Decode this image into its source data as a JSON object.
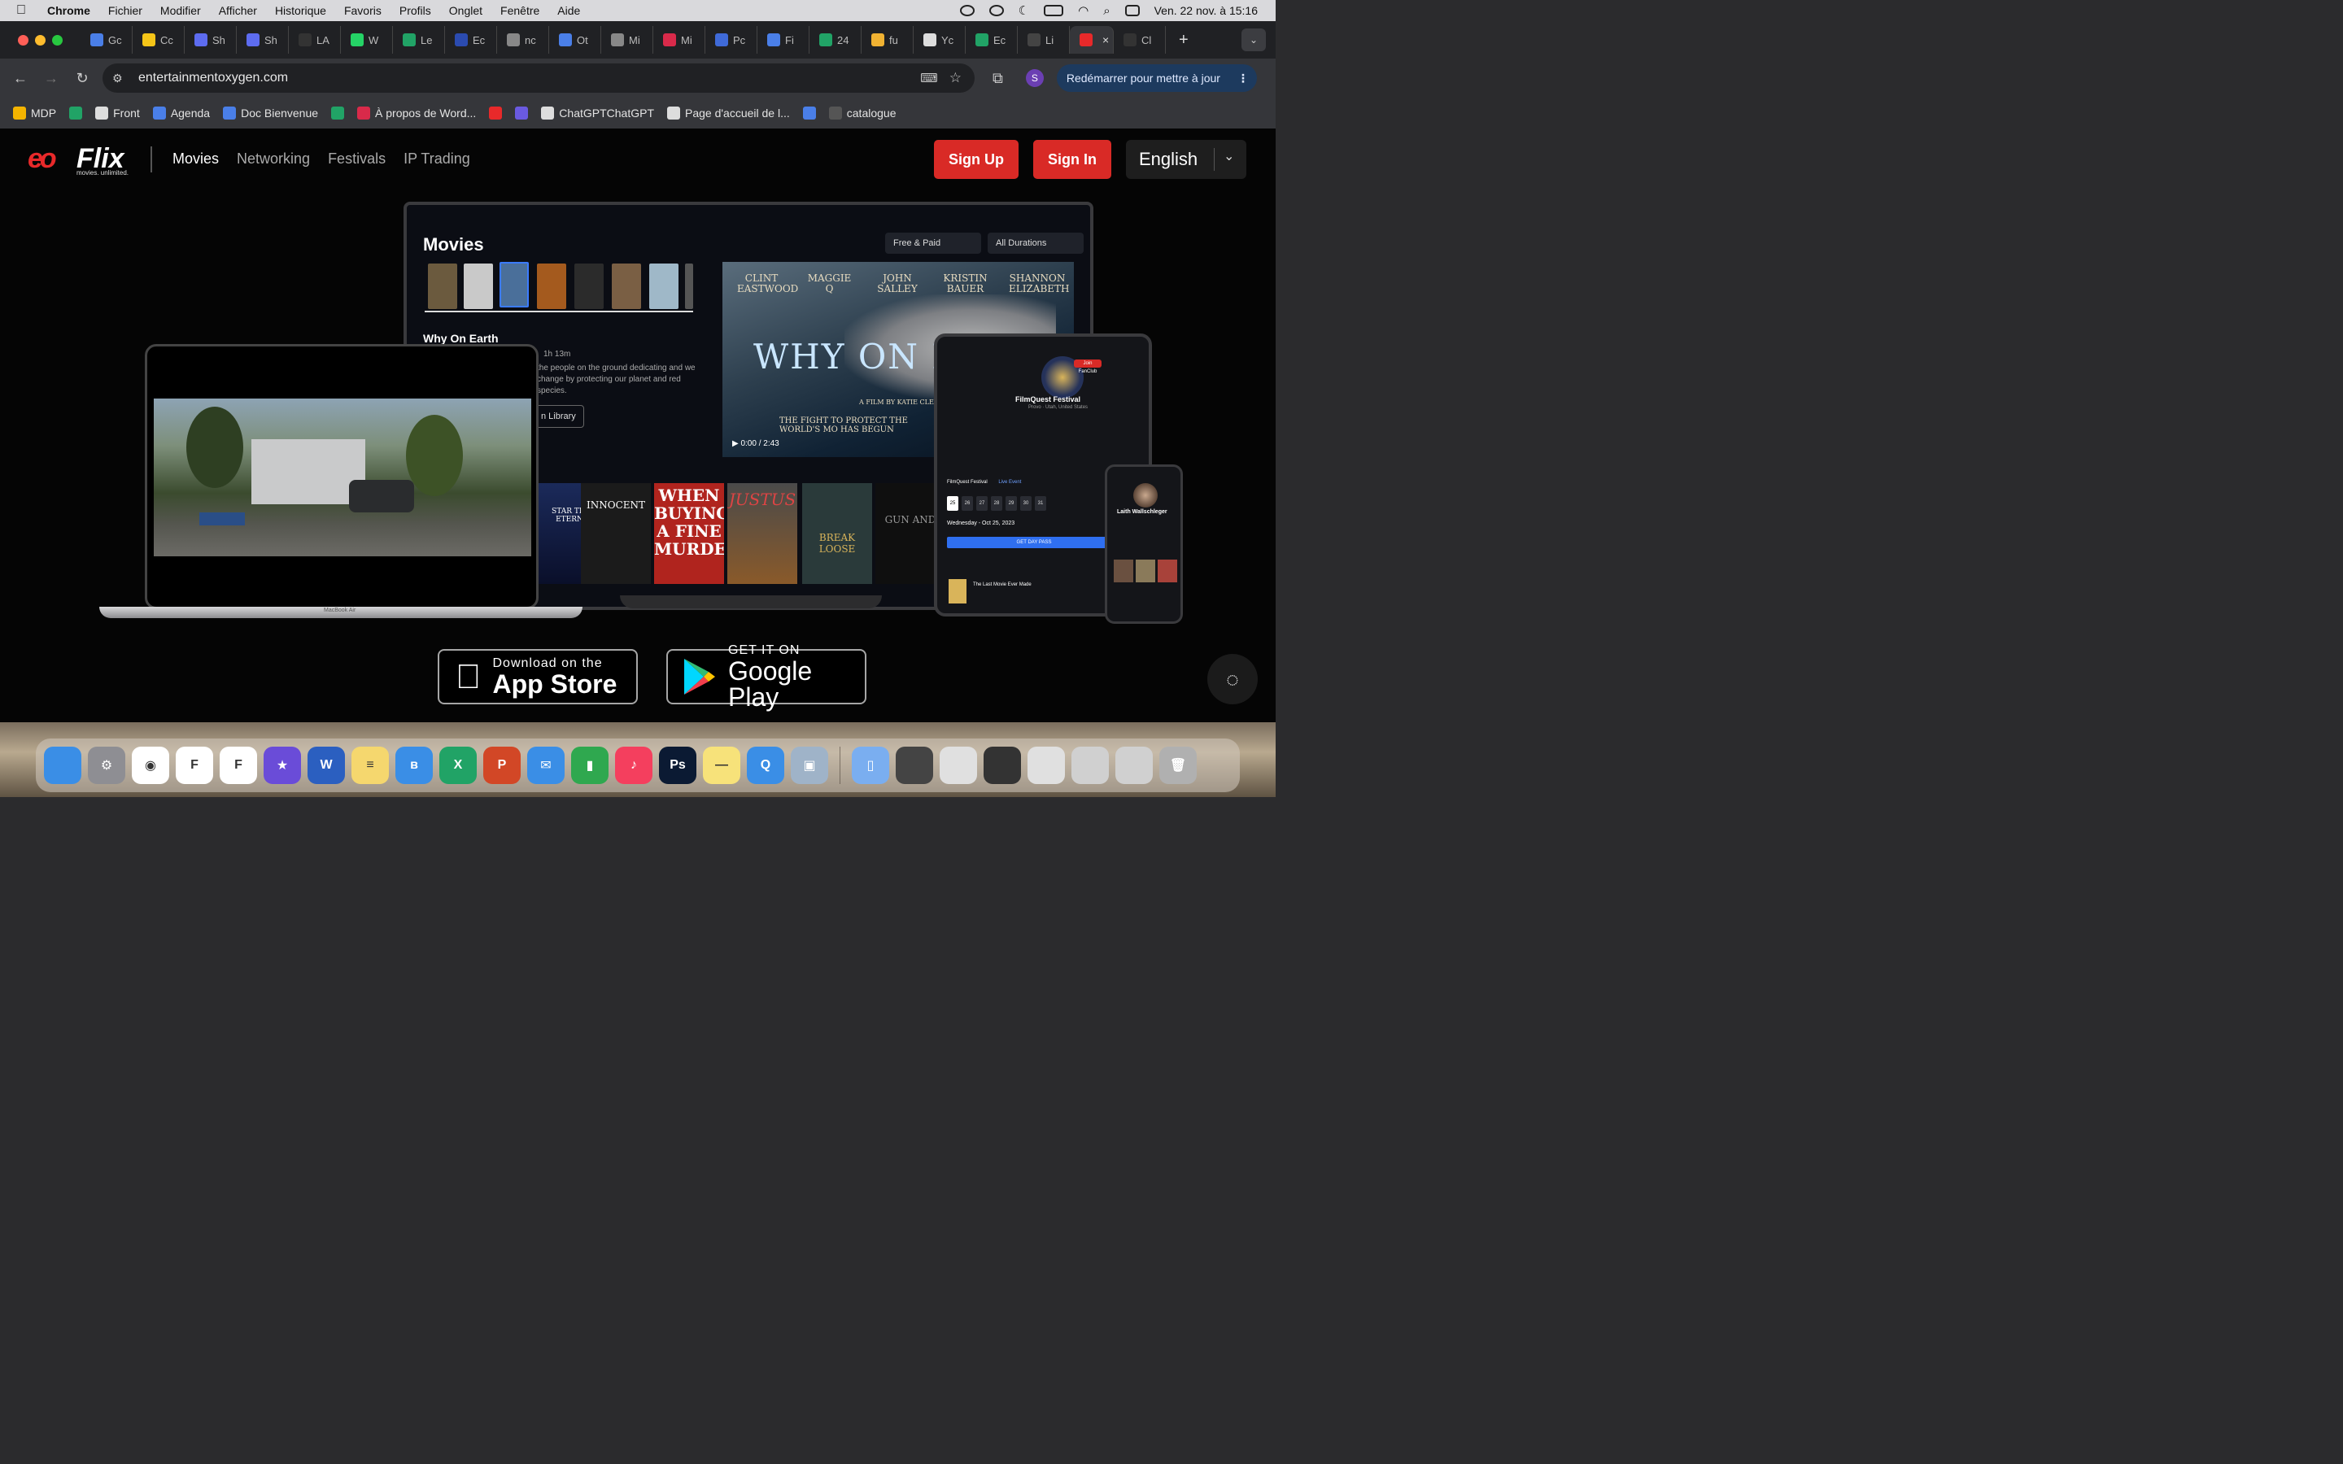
{
  "menubar": {
    "app": "Chrome",
    "items": [
      "Fichier",
      "Modifier",
      "Afficher",
      "Historique",
      "Favoris",
      "Profils",
      "Onglet",
      "Fenêtre",
      "Aide"
    ],
    "datetime": "Ven. 22 nov. à 15:16"
  },
  "tabs": [
    {
      "label": "Gc",
      "color": "#4a7fe8"
    },
    {
      "label": "Cc",
      "color": "#f5c518"
    },
    {
      "label": "Sh",
      "color": "#5d6cf0"
    },
    {
      "label": "Sh",
      "color": "#5d6cf0"
    },
    {
      "label": "LA",
      "color": "#333333"
    },
    {
      "label": "W",
      "color": "#25d366"
    },
    {
      "label": "Le",
      "color": "#21a366"
    },
    {
      "label": "Ec",
      "color": "#2b4bb0"
    },
    {
      "label": "nc",
      "color": "#888888"
    },
    {
      "label": "Ot",
      "color": "#4a7fe8"
    },
    {
      "label": "Mi",
      "color": "#888888"
    },
    {
      "label": "Mi",
      "color": "#d92a4a"
    },
    {
      "label": "Pc",
      "color": "#3f6ad8"
    },
    {
      "label": "Fi",
      "color": "#4a7fe8"
    },
    {
      "label": "24",
      "color": "#21a366"
    },
    {
      "label": "fu",
      "color": "#f0b232"
    },
    {
      "label": "Yc",
      "color": "#dddddd"
    },
    {
      "label": "Ec",
      "color": "#21a366"
    },
    {
      "label": "Li",
      "color": "#444444"
    },
    {
      "label": "",
      "color": "#e8292a",
      "active": true,
      "close": "×"
    },
    {
      "label": "Cl",
      "color": "#333333"
    }
  ],
  "newtab": "+",
  "toolbar": {
    "url": "entertainmentoxygen.com",
    "profile_initial": "S",
    "update_label": "Redémarrer pour mettre à jour",
    "update_dots": "⋮"
  },
  "bookmarks": [
    {
      "label": "MDP",
      "color": "#f4b400"
    },
    {
      "label": "",
      "color": "#21a366"
    },
    {
      "label": "Front",
      "color": "#dddddd"
    },
    {
      "label": "Agenda",
      "color": "#4a7fe8"
    },
    {
      "label": "Doc Bienvenue",
      "color": "#4a7fe8"
    },
    {
      "label": "",
      "color": "#21a366"
    },
    {
      "label": "À propos de Word...",
      "color": "#d92a4a"
    },
    {
      "label": "",
      "color": "#e8292a"
    },
    {
      "label": "",
      "color": "#6a5ae0"
    },
    {
      "label": "ChatGPTChatGPT",
      "color": "#dddddd"
    },
    {
      "label": "Page d'accueil de l...",
      "color": "#dddddd"
    },
    {
      "label": "",
      "color": "#4a7fe8"
    },
    {
      "label": "catalogue",
      "color": "#555555"
    }
  ],
  "site": {
    "logo_word": "Flix",
    "logo_tag": "movies. unlimited.",
    "nav": [
      "Movies",
      "Networking",
      "Festivals",
      "IP Trading"
    ],
    "signup": "Sign Up",
    "signin": "Sign In",
    "language": "English",
    "brand_red": "#d92a26"
  },
  "tv": {
    "title": "Movies",
    "filter1": "Free & Paid",
    "filter2": "All Durations",
    "cast": [
      "CLINT EASTWOOD",
      "MAGGIE Q",
      "JOHN SALLEY",
      "KRISTIN BAUER",
      "SHANNON ELIZABETH"
    ],
    "hero_title": "WHY ON E",
    "hero_credit": "A FILM BY KATIE CLEARY",
    "hero_tagline": "THE FIGHT TO PROTECT THE WORLD'S MO HAS BEGUN",
    "time": "0:00 / 2:43",
    "selected_title": "Why On Earth",
    "duration": "1h 13m",
    "description": "the people on the ground dedicating and we change by protecting our planet and red species.",
    "library_btn": "n Library",
    "row_titles": [
      "STAR TREK ETERNIA",
      "INNOCENT",
      "WHEN BUYING A FINE MURDER",
      "JUSTUS",
      "BREAK LOOSE",
      "GUN AND"
    ]
  },
  "laptop": {
    "label": "MacBook Air"
  },
  "tablet": {
    "festival": "FilmQuest Festival",
    "location": "Provo · Utah, United States",
    "join": "Join FanClub",
    "tab1": "FilmQuest Festival",
    "tab2": "Live Event",
    "dates": [
      "25",
      "26",
      "27",
      "28",
      "29",
      "30",
      "31"
    ],
    "when": "Wednesday - Oct 25, 2023",
    "daypass": "GET DAY PASS",
    "event": "The Last Movie Ever Made"
  },
  "phone": {
    "name": "Laith Wallschleger"
  },
  "stores": {
    "apple_small": "Download on the",
    "apple_large": "App Store",
    "google_small": "GET IT ON",
    "google_large": "Google Play"
  },
  "dock": [
    {
      "name": "finder",
      "color": "#3a8ee6",
      "glyph": ""
    },
    {
      "name": "system-settings",
      "color": "#8e8e93",
      "glyph": "⚙"
    },
    {
      "name": "chrome",
      "color": "#ffffff",
      "glyph": "◉"
    },
    {
      "name": "front",
      "color": "#ffffff",
      "glyph": "F"
    },
    {
      "name": "framer",
      "color": "#ffffff",
      "glyph": "F"
    },
    {
      "name": "imovie",
      "color": "#6a4cd8",
      "glyph": "★"
    },
    {
      "name": "word",
      "color": "#2b5fc0",
      "glyph": "W"
    },
    {
      "name": "notes",
      "color": "#f5d76e",
      "glyph": "≡"
    },
    {
      "name": "bluetooth",
      "color": "#3a8ee6",
      "glyph": "ʙ"
    },
    {
      "name": "excel",
      "color": "#21a366",
      "glyph": "X"
    },
    {
      "name": "powerpoint",
      "color": "#d24726",
      "glyph": "P"
    },
    {
      "name": "mail",
      "color": "#3a8ee6",
      "glyph": "✉"
    },
    {
      "name": "numbers",
      "color": "#2fa84f",
      "glyph": "▮"
    },
    {
      "name": "music",
      "color": "#f43f5e",
      "glyph": "♪"
    },
    {
      "name": "photoshop",
      "color": "#0b1a33",
      "glyph": "Ps"
    },
    {
      "name": "notes-app",
      "color": "#f7e27a",
      "glyph": "—"
    },
    {
      "name": "quicktime",
      "color": "#3a8ee6",
      "glyph": "Q"
    },
    {
      "name": "preview",
      "color": "#9fb3c8",
      "glyph": "▣"
    }
  ],
  "dock_recent": [
    {
      "name": "downloads-folder",
      "color": "#7aaef0",
      "glyph": "▯"
    },
    {
      "name": "window-1",
      "color": "#444444",
      "glyph": ""
    },
    {
      "name": "window-2",
      "color": "#e0e0e0",
      "glyph": ""
    },
    {
      "name": "window-3",
      "color": "#333333",
      "glyph": ""
    },
    {
      "name": "window-4",
      "color": "#e0e0e0",
      "glyph": ""
    },
    {
      "name": "window-5",
      "color": "#d0d0d0",
      "glyph": ""
    },
    {
      "name": "window-6",
      "color": "#d0d0d0",
      "glyph": ""
    },
    {
      "name": "trash",
      "color": "#b0b0b0",
      "glyph": "🗑"
    }
  ]
}
